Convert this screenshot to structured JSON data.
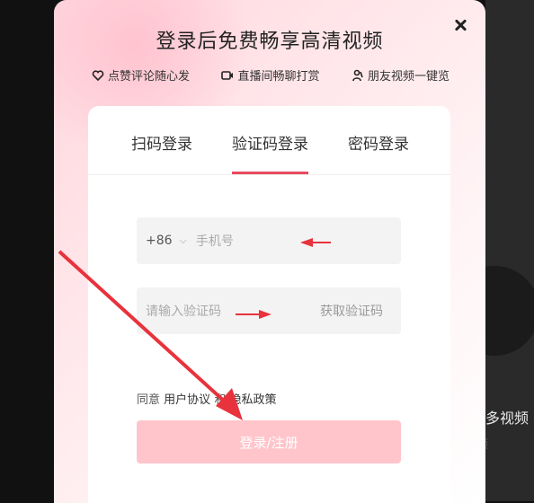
{
  "background": {
    "side_text": "多视频",
    "side_text2": "频"
  },
  "modal": {
    "title": "登录后免费畅享高清视频",
    "features": [
      {
        "icon": "heart-icon",
        "label": "点赞评论随心发"
      },
      {
        "icon": "live-icon",
        "label": "直播间畅聊打赏"
      },
      {
        "icon": "friends-icon",
        "label": "朋友视频一键览"
      }
    ],
    "tabs": [
      {
        "label": "扫码登录",
        "active": false
      },
      {
        "label": "验证码登录",
        "active": true
      },
      {
        "label": "密码登录",
        "active": false
      }
    ],
    "phone": {
      "country_code": "+86",
      "placeholder": "手机号"
    },
    "code": {
      "placeholder": "请输入验证码",
      "get_code_label": "获取验证码"
    },
    "agreement": {
      "prefix": "同意",
      "user_agreement": "用户协议",
      "and": "和",
      "privacy_policy": "隐私政策"
    },
    "submit_label": "登录/注册"
  },
  "colors": {
    "accent": "#e84a5f",
    "submit_bg": "#ffc5cb",
    "arrow": "#e8323c"
  }
}
